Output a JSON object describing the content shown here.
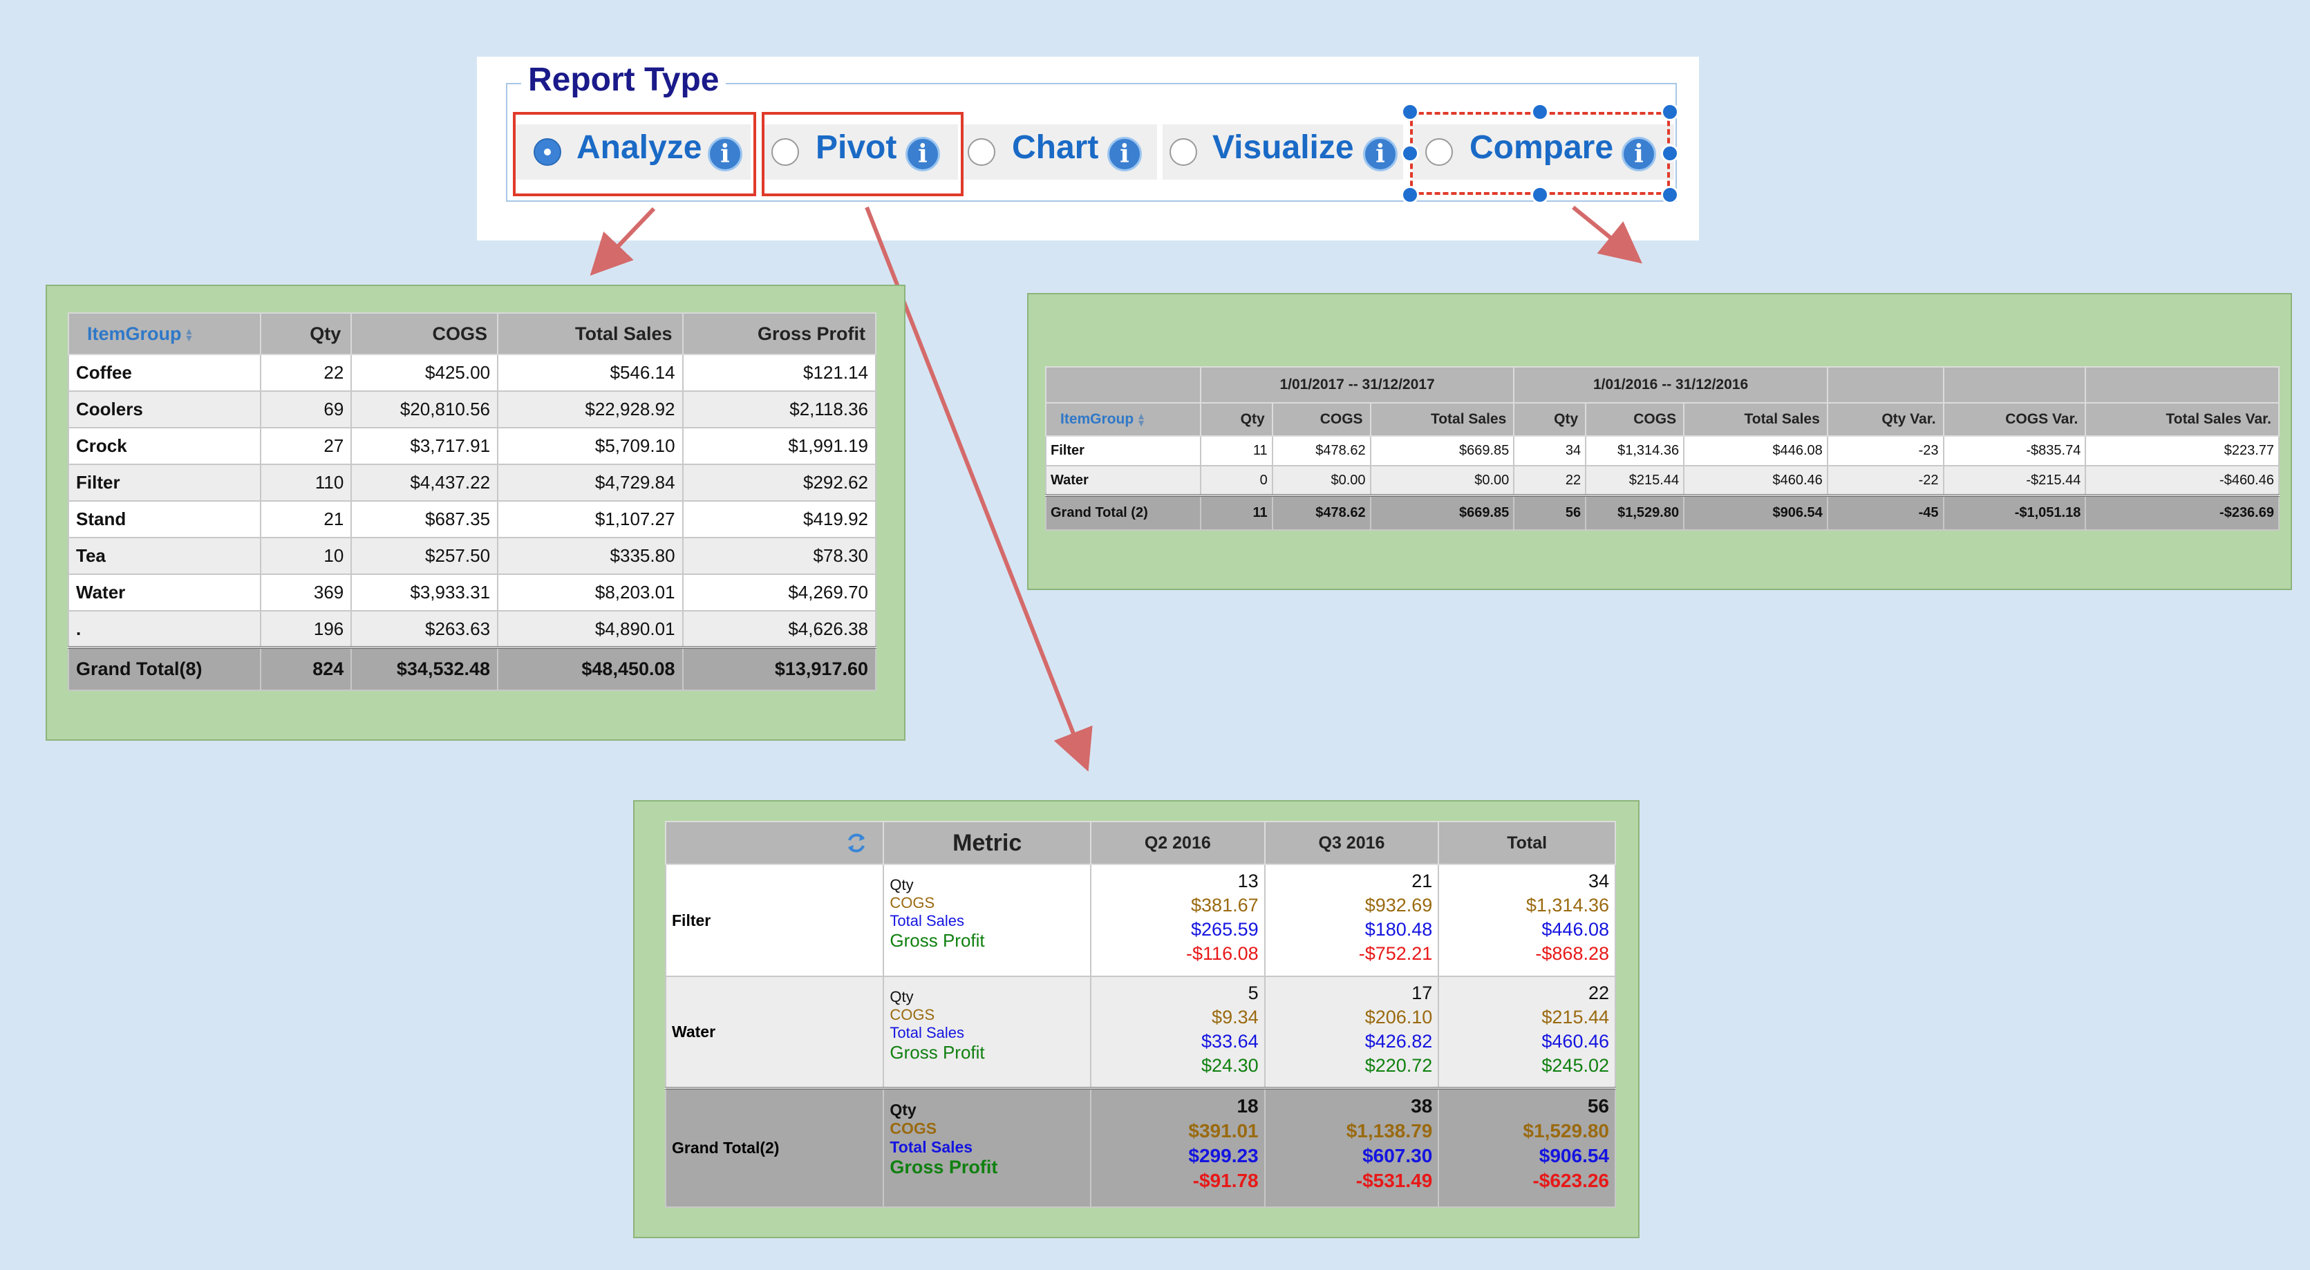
{
  "report_type": {
    "title": "Report Type",
    "options": [
      {
        "label": "Analyze",
        "selected": true
      },
      {
        "label": "Pivot",
        "selected": false
      },
      {
        "label": "Chart",
        "selected": false
      },
      {
        "label": "Visualize",
        "selected": false
      },
      {
        "label": "Compare",
        "selected": false
      }
    ],
    "info_glyph": "i"
  },
  "colors": {
    "background": "#d6e5f4",
    "panel_green": "#b5d6a7",
    "highlight_red": "#e03a2a",
    "handle_blue": "#1f6fd0"
  },
  "analyze": {
    "headers": [
      "ItemGroup",
      "Qty",
      "COGS",
      "Total Sales",
      "Gross Profit"
    ],
    "rows": [
      [
        "Coffee",
        "22",
        "$425.00",
        "$546.14",
        "$121.14"
      ],
      [
        "Coolers",
        "69",
        "$20,810.56",
        "$22,928.92",
        "$2,118.36"
      ],
      [
        "Crock",
        "27",
        "$3,717.91",
        "$5,709.10",
        "$1,991.19"
      ],
      [
        "Filter",
        "110",
        "$4,437.22",
        "$4,729.84",
        "$292.62"
      ],
      [
        "Stand",
        "21",
        "$687.35",
        "$1,107.27",
        "$419.92"
      ],
      [
        "Tea",
        "10",
        "$257.50",
        "$335.80",
        "$78.30"
      ],
      [
        "Water",
        "369",
        "$3,933.31",
        "$8,203.01",
        "$4,269.70"
      ],
      [
        ".",
        "196",
        "$263.63",
        "$4,890.01",
        "$4,626.38"
      ]
    ],
    "total": [
      "Grand Total(8)",
      "824",
      "$34,532.48",
      "$48,450.08",
      "$13,917.60"
    ]
  },
  "compare": {
    "period1": "1/01/2017 -- 31/12/2017",
    "period2": "1/01/2016 -- 31/12/2016",
    "headers": [
      "ItemGroup",
      "Qty",
      "COGS",
      "Total Sales",
      "Qty",
      "COGS",
      "Total Sales",
      "Qty Var.",
      "COGS Var.",
      "Total Sales Var."
    ],
    "rows": [
      [
        "Filter",
        "11",
        "$478.62",
        "$669.85",
        "34",
        "$1,314.36",
        "$446.08",
        "-23",
        "-$835.74",
        "$223.77"
      ],
      [
        "Water",
        "0",
        "$0.00",
        "$0.00",
        "22",
        "$215.44",
        "$460.46",
        "-22",
        "-$215.44",
        "-$460.46"
      ]
    ],
    "total": [
      "Grand Total (2)",
      "11",
      "$478.62",
      "$669.85",
      "56",
      "$1,529.80",
      "$906.54",
      "-45",
      "-$1,051.18",
      "-$236.69"
    ]
  },
  "pivot": {
    "headers": [
      "",
      "Metric",
      "Q2 2016",
      "Q3 2016",
      "Total"
    ],
    "metrics": [
      "Qty",
      "COGS",
      "Total Sales",
      "Gross Profit"
    ],
    "rows": [
      {
        "label": "Filter",
        "cols": [
          [
            "13",
            "$381.67",
            "$265.59",
            "-$116.08"
          ],
          [
            "21",
            "$932.69",
            "$180.48",
            "-$752.21"
          ],
          [
            "34",
            "$1,314.36",
            "$446.08",
            "-$868.28"
          ]
        ]
      },
      {
        "label": "Water",
        "cols": [
          [
            "5",
            "$9.34",
            "$33.64",
            "$24.30"
          ],
          [
            "17",
            "$206.10",
            "$426.82",
            "$220.72"
          ],
          [
            "22",
            "$215.44",
            "$460.46",
            "$245.02"
          ]
        ]
      }
    ],
    "total": {
      "label": "Grand Total(2)",
      "cols": [
        [
          "18",
          "$391.01",
          "$299.23",
          "-$91.78"
        ],
        [
          "38",
          "$1,138.79",
          "$607.30",
          "-$531.49"
        ],
        [
          "56",
          "$1,529.80",
          "$906.54",
          "-$623.26"
        ]
      ]
    }
  }
}
